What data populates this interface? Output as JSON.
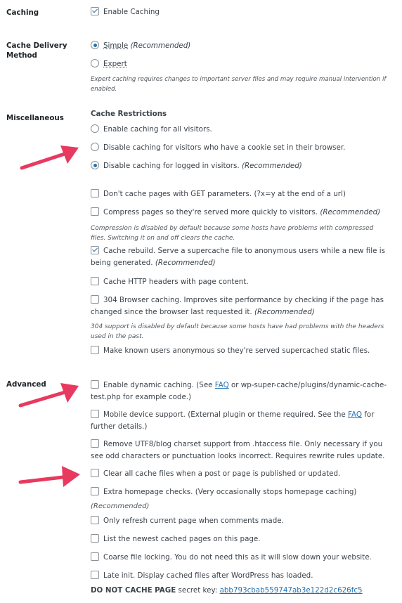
{
  "sections": {
    "caching": {
      "label": "Caching",
      "enable": {
        "label": "Enable Caching",
        "checked": true
      }
    },
    "delivery": {
      "label": "Cache Delivery Method",
      "simple": {
        "label": "Simple",
        "note": "(Recommended)",
        "checked": true
      },
      "expert": {
        "label": "Expert",
        "checked": false
      },
      "desc": "Expert caching requires changes to important server files and may require manual intervention if enabled."
    },
    "misc": {
      "label": "Miscellaneous",
      "restrictions_title": "Cache Restrictions",
      "r1": {
        "label": "Enable caching for all visitors.",
        "checked": false
      },
      "r2": {
        "label": "Disable caching for visitors who have a cookie set in their browser.",
        "checked": false
      },
      "r3": {
        "label": "Disable caching for logged in visitors.",
        "note": "(Recommended)",
        "checked": true
      },
      "get_params": {
        "label": "Don't cache pages with GET parameters. (?x=y at the end of a url)",
        "checked": false
      },
      "compress": {
        "label": "Compress pages so they're served more quickly to visitors.",
        "note": "(Recommended)",
        "checked": false
      },
      "compress_desc": "Compression is disabled by default because some hosts have problems with compressed files. Switching it on and off clears the cache.",
      "rebuild": {
        "label": "Cache rebuild. Serve a supercache file to anonymous users while a new file is being generated.",
        "note": "(Recommended)",
        "checked": true
      },
      "http_headers": {
        "label": "Cache HTTP headers with page content.",
        "checked": false
      },
      "browser304": {
        "label": "304 Browser caching. Improves site performance by checking if the page has changed since the browser last requested it.",
        "note": "(Recommended)",
        "checked": false
      },
      "browser304_desc": "304 support is disabled by default because some hosts have had problems with the headers used in the past.",
      "anon": {
        "label": "Make known users anonymous so they're served supercached static files.",
        "checked": false
      }
    },
    "advanced": {
      "label": "Advanced",
      "dynamic": {
        "pre": "Enable dynamic caching. (See ",
        "link": "FAQ",
        "post": " or wp-super-cache/plugins/dynamic-cache-test.php for example code.)",
        "checked": false
      },
      "mobile": {
        "pre": "Mobile device support. (External plugin or theme required. See the ",
        "link": "FAQ",
        "post": " for further details.)",
        "checked": false
      },
      "utf8": {
        "label": "Remove UTF8/blog charset support from .htaccess file. Only necessary if you see odd characters or punctuation looks incorrect. Requires rewrite rules update.",
        "checked": false
      },
      "clear_all": {
        "label": "Clear all cache files when a post or page is published or updated.",
        "checked": false
      },
      "homepage": {
        "label": "Extra homepage checks. (Very occasionally stops homepage caching)",
        "checked": false
      },
      "homepage_note": "(Recommended)",
      "refresh": {
        "label": "Only refresh current page when comments made.",
        "checked": false
      },
      "list_newest": {
        "label": "List the newest cached pages on this page.",
        "checked": false
      },
      "coarse": {
        "label": "Coarse file locking. You do not need this as it will slow down your website.",
        "checked": false
      },
      "late_init": {
        "label": "Late init. Display cached files after WordPress has loaded.",
        "checked": false
      },
      "secret_label": "DO NOT CACHE PAGE",
      "secret_text": " secret key: ",
      "secret_key": "abb793cbab559747ab3e122d2c626fc5"
    }
  },
  "colors": {
    "accent": "#2271b1",
    "arrow": "#e8395f"
  }
}
